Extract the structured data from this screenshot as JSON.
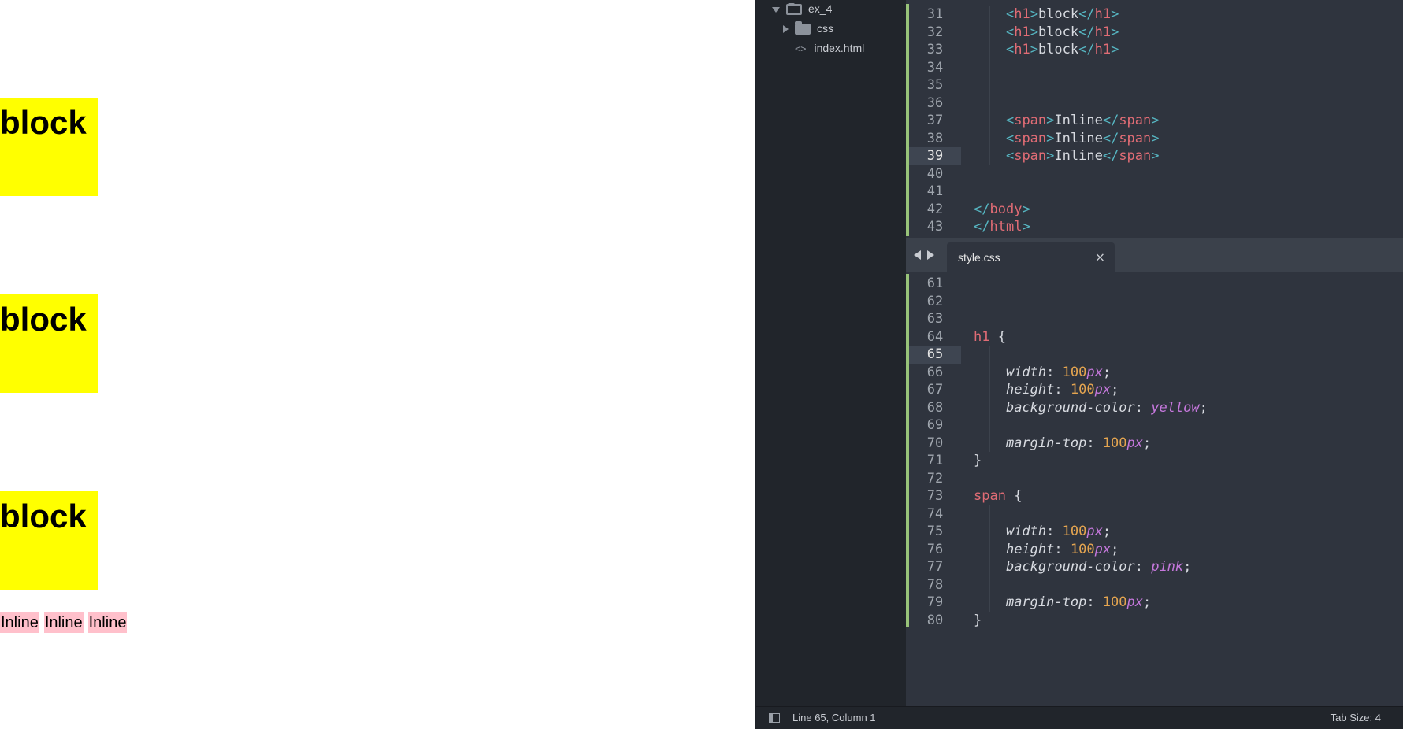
{
  "preview": {
    "headings": [
      "block",
      "block",
      "block"
    ],
    "spans": [
      "Inline",
      "Inline",
      "Inline"
    ],
    "colors": {
      "block_bg": "#ffff00",
      "inline_bg": "#ffc0cb"
    }
  },
  "sidebar": {
    "root": "ex_4",
    "items": [
      {
        "label": "css",
        "icon": "folder-icon"
      },
      {
        "label": "index.html",
        "icon": "code-file-icon"
      }
    ]
  },
  "html_pane": {
    "lines": [
      {
        "n": "31",
        "indent": "    ",
        "tag": "h1",
        "text": "block"
      },
      {
        "n": "32",
        "indent": "    ",
        "tag": "h1",
        "text": "block"
      },
      {
        "n": "33",
        "indent": "    ",
        "tag": "h1",
        "text": "block"
      },
      {
        "n": "34"
      },
      {
        "n": "35"
      },
      {
        "n": "36"
      },
      {
        "n": "37",
        "indent": "    ",
        "tag": "span",
        "text": "Inline"
      },
      {
        "n": "38",
        "indent": "    ",
        "tag": "span",
        "text": "Inline"
      },
      {
        "n": "39",
        "indent": "    ",
        "tag": "span",
        "text": "Inline",
        "current": true
      },
      {
        "n": "40"
      },
      {
        "n": "41"
      },
      {
        "n": "42",
        "close": "body"
      },
      {
        "n": "43",
        "close": "html"
      }
    ]
  },
  "tab": {
    "title": "style.css",
    "close": "×"
  },
  "css_pane": {
    "lines": [
      {
        "n": "61"
      },
      {
        "n": "62"
      },
      {
        "n": "63"
      },
      {
        "n": "64",
        "selector": "h1"
      },
      {
        "n": "65",
        "current": true
      },
      {
        "n": "66",
        "prop": "width",
        "num": "100",
        "unit": "px"
      },
      {
        "n": "67",
        "prop": "height",
        "num": "100",
        "unit": "px"
      },
      {
        "n": "68",
        "prop": "background-color",
        "value": "yellow"
      },
      {
        "n": "69"
      },
      {
        "n": "70",
        "prop": "margin-top",
        "num": "100",
        "unit": "px"
      },
      {
        "n": "71",
        "brace": "}"
      },
      {
        "n": "72"
      },
      {
        "n": "73",
        "selector": "span"
      },
      {
        "n": "74"
      },
      {
        "n": "75",
        "prop": "width",
        "num": "100",
        "unit": "px"
      },
      {
        "n": "76",
        "prop": "height",
        "num": "100",
        "unit": "px"
      },
      {
        "n": "77",
        "prop": "background-color",
        "value": "pink"
      },
      {
        "n": "78"
      },
      {
        "n": "79",
        "prop": "margin-top",
        "num": "100",
        "unit": "px"
      },
      {
        "n": "80",
        "brace": "}"
      }
    ]
  },
  "status": {
    "position": "Line 65, Column 1",
    "tab_size": "Tab Size: 4"
  }
}
